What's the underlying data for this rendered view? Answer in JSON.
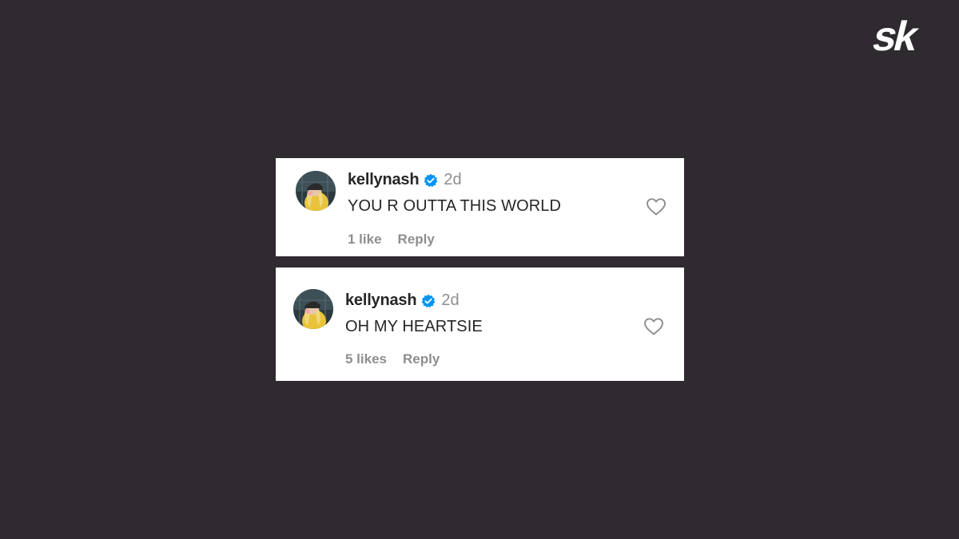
{
  "brand": {
    "logo_text": "sk",
    "color": "#ffffff"
  },
  "comments": [
    {
      "username": "kellynash",
      "verified": true,
      "time_ago": "2d",
      "text": "YOU R OUTTA THIS WORLD",
      "likes_label": "1 like",
      "reply_label": "Reply"
    },
    {
      "username": "kellynash",
      "verified": true,
      "time_ago": "2d",
      "text": "OH MY HEARTSIE",
      "likes_label": "5 likes",
      "reply_label": "Reply"
    }
  ],
  "colors": {
    "background": "#2e2a2f",
    "verified_badge": "#0095f6",
    "primary_text": "#262626",
    "secondary_text": "#8e8e8e"
  },
  "icons": {
    "verified": "verified-badge-icon",
    "like": "heart-outline-icon",
    "brand": "sk-logo-icon"
  }
}
